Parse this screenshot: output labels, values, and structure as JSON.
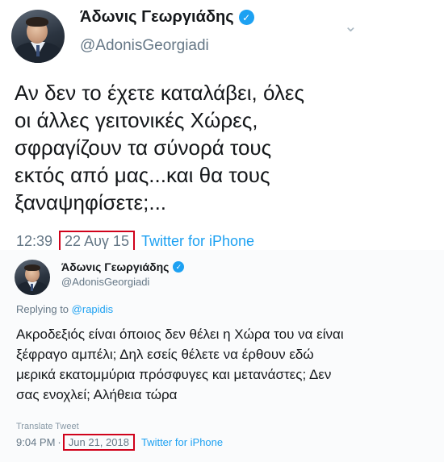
{
  "tweet_primary": {
    "author_name": "Άδωνις Γεωργιάδης",
    "verified_icon": "verified-badge-icon",
    "handle": "@AdonisGeorgiadi",
    "menu_icon": "chevron-down-icon",
    "text": "Αν δεν το έχετε καταλάβει, όλες\nοι άλλες γειτονικές Χώρες,\nσφραγίζουν τα σύνορά τους\nεκτός από μας...και θα τους\nξαναψηφίσετε;...",
    "time": "12:39",
    "date": "22 Αυγ 15",
    "source": "Twitter for iPhone",
    "highlight_color": "#d0021b"
  },
  "tweet_reply": {
    "author_name": "Άδωνις Γεωργιάδης",
    "verified_icon": "verified-badge-icon",
    "handle": "@AdonisGeorgiadi",
    "replying_prefix": "Replying to",
    "replying_to": "@rapidis",
    "text": "Ακροδεξιός είναι όποιος δεν θέλει η Χώρα του να είναι\nξέφραγο αμπέλι; Δηλ εσείς θέλετε να έρθουν εδώ\nμερικά εκατομμύρια πρόσφυγες και μετανάστες; Δεν\nσας ενοχλεί; Αλήθεια τώρα",
    "translate_label": "Translate Tweet",
    "time": "9:04 PM",
    "separator": "·",
    "date": "Jun 21, 2018",
    "source": "Twitter for iPhone",
    "highlight_color": "#d0021b"
  },
  "colors": {
    "link_blue": "#1da1f2",
    "secondary_gray": "#657786",
    "text": "#14171a"
  }
}
